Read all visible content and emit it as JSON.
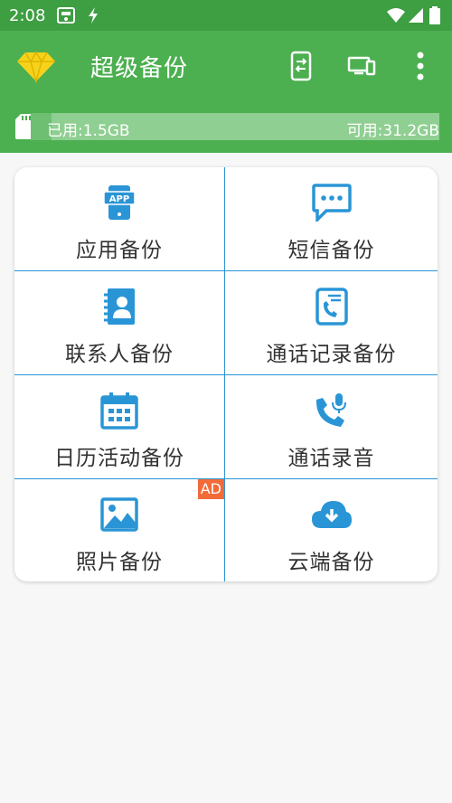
{
  "status_bar": {
    "time": "2:08"
  },
  "app_bar": {
    "title": "超级备份"
  },
  "storage": {
    "used": "已用:1.5GB",
    "free": "可用:31.2GB",
    "used_fraction": 0.05
  },
  "grid": [
    {
      "label": "应用备份",
      "icon": "app-icon",
      "badge": ""
    },
    {
      "label": "短信备份",
      "icon": "sms-icon",
      "badge": ""
    },
    {
      "label": "联系人备份",
      "icon": "contacts-icon",
      "badge": ""
    },
    {
      "label": "通话记录备份",
      "icon": "call-log-icon",
      "badge": ""
    },
    {
      "label": "日历活动备份",
      "icon": "calendar-icon",
      "badge": ""
    },
    {
      "label": "通话录音",
      "icon": "call-recording-icon",
      "badge": ""
    },
    {
      "label": "照片备份",
      "icon": "photo-icon",
      "badge": "AD"
    },
    {
      "label": "云端备份",
      "icon": "cloud-download-icon",
      "badge": ""
    }
  ],
  "colors": {
    "primary": "#4caf50",
    "status": "#3e9e42",
    "accent": "#2a95d6",
    "ad": "#f26b38"
  }
}
